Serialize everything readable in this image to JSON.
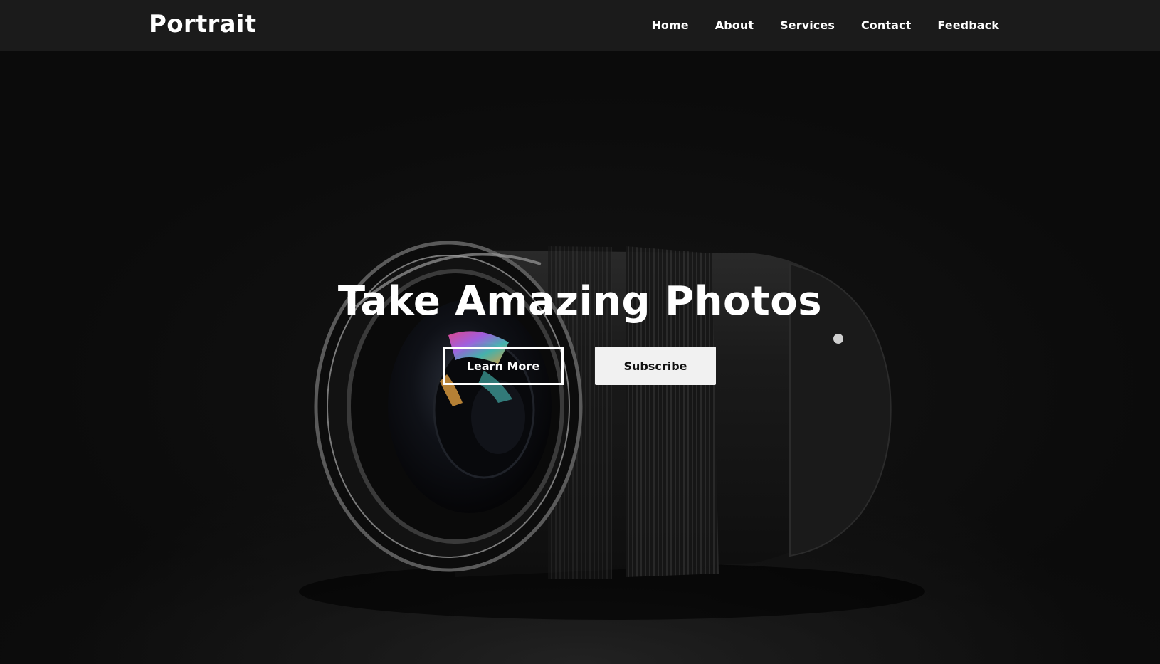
{
  "header": {
    "brand": "Portrait",
    "nav": [
      {
        "label": "Home"
      },
      {
        "label": "About"
      },
      {
        "label": "Services"
      },
      {
        "label": "Contact"
      },
      {
        "label": "Feedback"
      }
    ]
  },
  "hero": {
    "title": "Take Amazing Photos",
    "buttons": {
      "learn_more": "Learn More",
      "subscribe": "Subscribe"
    },
    "background_image": "camera-lens-photo"
  },
  "colors": {
    "navbar_bg": "#1b1b1b",
    "hero_bg": "#0a0a0a",
    "text": "#ffffff",
    "button_solid_bg": "#f1f1f1",
    "button_solid_text": "#111111"
  }
}
